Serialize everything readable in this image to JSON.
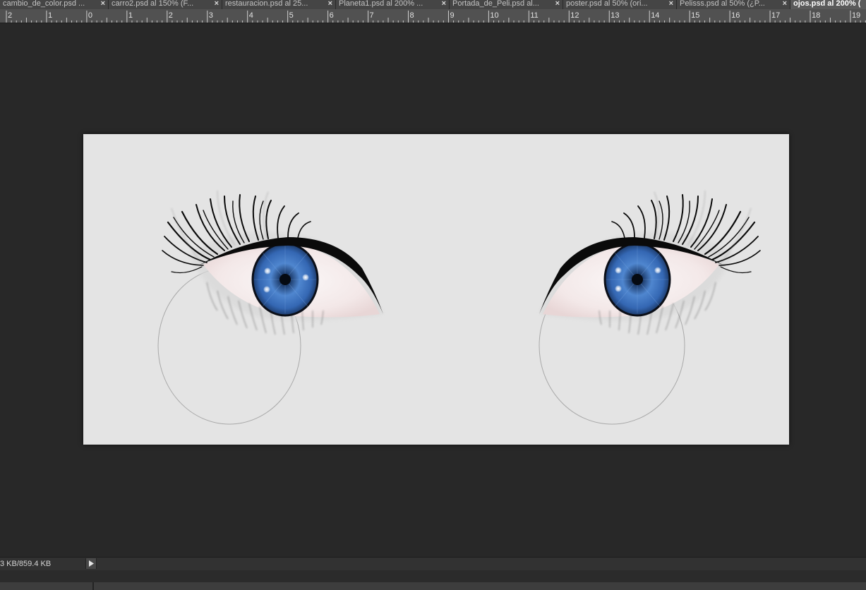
{
  "tabs": [
    {
      "label": "cambio_de_color.psd ...",
      "active": false
    },
    {
      "label": "carro2.psd al 150% (F...",
      "active": false
    },
    {
      "label": "restauracion.psd al 25...",
      "active": false
    },
    {
      "label": "Planeta1.psd al 200% ...",
      "active": false
    },
    {
      "label": "Portada_de_Peli.psd al...",
      "active": false
    },
    {
      "label": "poster.psd al 50% (ori...",
      "active": false
    },
    {
      "label": "Pelisss.psd al 50% (¿P...",
      "active": false
    },
    {
      "label": "ojos.psd al 200% (",
      "active": true
    }
  ],
  "tab_close_glyph": "×",
  "ruler": {
    "labels": [
      "2",
      "1",
      "0",
      "1",
      "2",
      "3",
      "4",
      "5",
      "6",
      "7",
      "8",
      "9",
      "10",
      "11",
      "12",
      "13",
      "14",
      "15",
      "16",
      "17",
      "18",
      "19"
    ]
  },
  "canvas": {
    "background": "#e4e4e4",
    "iris_color": "#3a6fb8",
    "lash_color": "#0a0a0a"
  },
  "status": {
    "doc_size": "3 KB/859.4 KB",
    "menu_icon": "triangle-right-icon"
  },
  "colors": {
    "app_bg": "#282828",
    "tab_bg": "#454545",
    "tab_active_bg": "#5a5a5a",
    "ruler_bg": "#515151"
  }
}
